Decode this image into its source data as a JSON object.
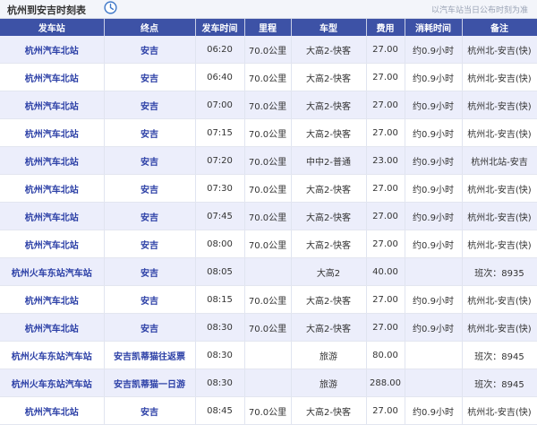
{
  "header": {
    "title": "杭州到安吉时刻表",
    "note": "以汽车站当日公布时刻为准",
    "icon": "clock-icon"
  },
  "table": {
    "columns": [
      "发车站",
      "终点",
      "发车时间",
      "里程",
      "车型",
      "费用",
      "消耗时间",
      "备注"
    ],
    "rows": [
      {
        "station": "杭州汽车北站",
        "dest": "安吉",
        "time": "06:20",
        "distance": "70.0公里",
        "type": "大高2-快客",
        "fare": "27.00",
        "duration": "约0.9小时",
        "remark": "杭州北-安吉(快)"
      },
      {
        "station": "杭州汽车北站",
        "dest": "安吉",
        "time": "06:40",
        "distance": "70.0公里",
        "type": "大高2-快客",
        "fare": "27.00",
        "duration": "约0.9小时",
        "remark": "杭州北-安吉(快)"
      },
      {
        "station": "杭州汽车北站",
        "dest": "安吉",
        "time": "07:00",
        "distance": "70.0公里",
        "type": "大高2-快客",
        "fare": "27.00",
        "duration": "约0.9小时",
        "remark": "杭州北-安吉(快)"
      },
      {
        "station": "杭州汽车北站",
        "dest": "安吉",
        "time": "07:15",
        "distance": "70.0公里",
        "type": "大高2-快客",
        "fare": "27.00",
        "duration": "约0.9小时",
        "remark": "杭州北-安吉(快)"
      },
      {
        "station": "杭州汽车北站",
        "dest": "安吉",
        "time": "07:20",
        "distance": "70.0公里",
        "type": "中中2-普通",
        "fare": "23.00",
        "duration": "约0.9小时",
        "remark": "杭州北站-安吉"
      },
      {
        "station": "杭州汽车北站",
        "dest": "安吉",
        "time": "07:30",
        "distance": "70.0公里",
        "type": "大高2-快客",
        "fare": "27.00",
        "duration": "约0.9小时",
        "remark": "杭州北-安吉(快)"
      },
      {
        "station": "杭州汽车北站",
        "dest": "安吉",
        "time": "07:45",
        "distance": "70.0公里",
        "type": "大高2-快客",
        "fare": "27.00",
        "duration": "约0.9小时",
        "remark": "杭州北-安吉(快)"
      },
      {
        "station": "杭州汽车北站",
        "dest": "安吉",
        "time": "08:00",
        "distance": "70.0公里",
        "type": "大高2-快客",
        "fare": "27.00",
        "duration": "约0.9小时",
        "remark": "杭州北-安吉(快)"
      },
      {
        "station": "杭州火车东站汽车站",
        "dest": "安吉",
        "time": "08:05",
        "distance": "",
        "type": "大高2",
        "fare": "40.00",
        "duration": "",
        "remark": "班次：8935"
      },
      {
        "station": "杭州汽车北站",
        "dest": "安吉",
        "time": "08:15",
        "distance": "70.0公里",
        "type": "大高2-快客",
        "fare": "27.00",
        "duration": "约0.9小时",
        "remark": "杭州北-安吉(快)"
      },
      {
        "station": "杭州汽车北站",
        "dest": "安吉",
        "time": "08:30",
        "distance": "70.0公里",
        "type": "大高2-快客",
        "fare": "27.00",
        "duration": "约0.9小时",
        "remark": "杭州北-安吉(快)"
      },
      {
        "station": "杭州火车东站汽车站",
        "dest": "安吉凯蒂猫往返票",
        "time": "08:30",
        "distance": "",
        "type": "旅游",
        "fare": "80.00",
        "duration": "",
        "remark": "班次：8945"
      },
      {
        "station": "杭州火车东站汽车站",
        "dest": "安吉凯蒂猫一日游",
        "time": "08:30",
        "distance": "",
        "type": "旅游",
        "fare": "288.00",
        "duration": "",
        "remark": "班次：8945"
      },
      {
        "station": "杭州汽车北站",
        "dest": "安吉",
        "time": "08:45",
        "distance": "70.0公里",
        "type": "大高2-快客",
        "fare": "27.00",
        "duration": "约0.9小时",
        "remark": "杭州北-安吉(快)"
      }
    ]
  },
  "colors": {
    "header_bg": "#3d52a6",
    "even_row_bg": "#eceefb",
    "link_text": "#2b3fa6"
  }
}
